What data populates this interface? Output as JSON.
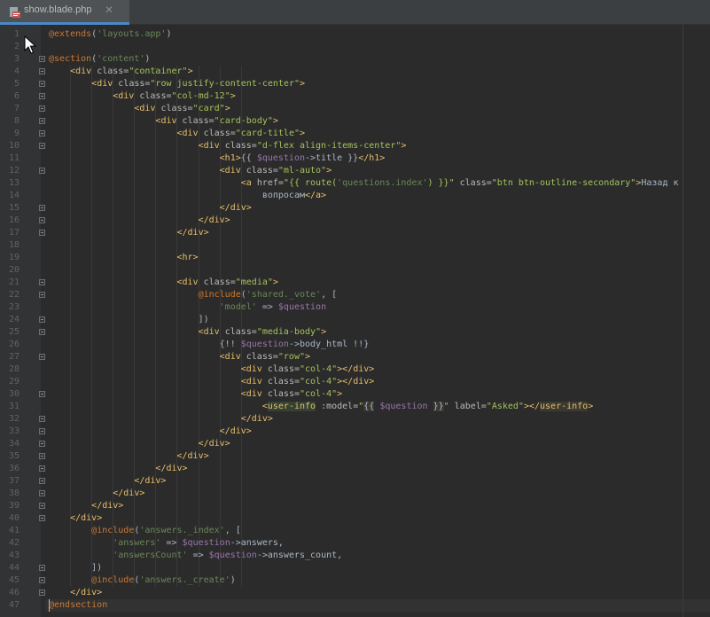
{
  "tab": {
    "title": "show.blade.php",
    "close_icon": "close-icon",
    "file_icon": "blade-file-icon",
    "accent": "#4a88c7"
  },
  "editor": {
    "line_numbers": [
      "1",
      "2",
      "3",
      "4",
      "5",
      "6",
      "7",
      "8",
      "9",
      "10",
      "11",
      "12",
      "13",
      "14",
      "15",
      "16",
      "17",
      "18",
      "19",
      "20",
      "21",
      "22",
      "23",
      "24",
      "25",
      "26",
      "27",
      "28",
      "29",
      "30",
      "31",
      "32",
      "33",
      "34",
      "35",
      "36",
      "37",
      "38",
      "39",
      "40",
      "41",
      "42",
      "43",
      "44",
      "45",
      "46",
      "47"
    ],
    "lines": [
      [
        [
          "t-dir",
          "@extends"
        ],
        [
          "t-txt",
          "("
        ],
        [
          "t-str",
          "'layouts.app'"
        ],
        [
          "t-txt",
          ")"
        ]
      ],
      [],
      [
        [
          "t-dir",
          "@section"
        ],
        [
          "t-txt",
          "("
        ],
        [
          "t-str",
          "'content'"
        ],
        [
          "t-txt",
          ")"
        ]
      ],
      [
        [
          "t-txt",
          "    "
        ],
        [
          "t-tag",
          "<div "
        ],
        [
          "t-attr",
          "class="
        ],
        [
          "t-val",
          "\"container\""
        ],
        [
          "t-tag",
          ">"
        ]
      ],
      [
        [
          "t-txt",
          "        "
        ],
        [
          "t-tag",
          "<div "
        ],
        [
          "t-attr",
          "class="
        ],
        [
          "t-val",
          "\"row justify-content-center\""
        ],
        [
          "t-tag",
          ">"
        ]
      ],
      [
        [
          "t-txt",
          "            "
        ],
        [
          "t-tag",
          "<div "
        ],
        [
          "t-attr",
          "class="
        ],
        [
          "t-val",
          "\"col-md-12\""
        ],
        [
          "t-tag",
          ">"
        ]
      ],
      [
        [
          "t-txt",
          "                "
        ],
        [
          "t-tag",
          "<div "
        ],
        [
          "t-attr",
          "class="
        ],
        [
          "t-val",
          "\"card\""
        ],
        [
          "t-tag",
          ">"
        ]
      ],
      [
        [
          "t-txt",
          "                    "
        ],
        [
          "t-tag",
          "<div "
        ],
        [
          "t-attr",
          "class="
        ],
        [
          "t-val",
          "\"card-body\""
        ],
        [
          "t-tag",
          ">"
        ]
      ],
      [
        [
          "t-txt",
          "                        "
        ],
        [
          "t-tag",
          "<div "
        ],
        [
          "t-attr",
          "class="
        ],
        [
          "t-val",
          "\"card-title\""
        ],
        [
          "t-tag",
          ">"
        ]
      ],
      [
        [
          "t-txt",
          "                            "
        ],
        [
          "t-tag",
          "<div "
        ],
        [
          "t-attr",
          "class="
        ],
        [
          "t-val",
          "\"d-flex align-items-center\""
        ],
        [
          "t-tag",
          ">"
        ]
      ],
      [
        [
          "t-txt",
          "                                "
        ],
        [
          "t-tag",
          "<h1>"
        ],
        [
          "t-txt",
          "{{ "
        ],
        [
          "t-var",
          "$question"
        ],
        [
          "t-txt",
          "->title }}"
        ],
        [
          "t-tag",
          "</h1>"
        ]
      ],
      [
        [
          "t-txt",
          "                                "
        ],
        [
          "t-tag",
          "<div "
        ],
        [
          "t-attr",
          "class="
        ],
        [
          "t-val",
          "\"ml-auto\""
        ],
        [
          "t-tag",
          ">"
        ]
      ],
      [
        [
          "t-txt",
          "                                    "
        ],
        [
          "t-tag",
          "<a "
        ],
        [
          "t-attr",
          "href="
        ],
        [
          "t-val",
          "\"{{ route("
        ],
        [
          "t-str",
          "'questions.index'"
        ],
        [
          "t-val",
          ") }}\""
        ],
        [
          "t-txt",
          " "
        ],
        [
          "t-attr",
          "class="
        ],
        [
          "t-val",
          "\"btn btn-outline-secondary\""
        ],
        [
          "t-tag",
          ">"
        ],
        [
          "t-txt",
          "Назад к"
        ]
      ],
      [
        [
          "t-txt",
          "                                        вопросам"
        ],
        [
          "t-tag",
          "</a>"
        ]
      ],
      [
        [
          "t-txt",
          "                                "
        ],
        [
          "t-tag",
          "</div>"
        ]
      ],
      [
        [
          "t-txt",
          "                            "
        ],
        [
          "t-tag",
          "</div>"
        ]
      ],
      [
        [
          "t-txt",
          "                        "
        ],
        [
          "t-tag",
          "</div>"
        ]
      ],
      [],
      [
        [
          "t-txt",
          "                        "
        ],
        [
          "t-tag",
          "<hr>"
        ]
      ],
      [],
      [
        [
          "t-txt",
          "                        "
        ],
        [
          "t-tag",
          "<div "
        ],
        [
          "t-attr",
          "class="
        ],
        [
          "t-val",
          "\"media\""
        ],
        [
          "t-tag",
          ">"
        ]
      ],
      [
        [
          "t-txt",
          "                            "
        ],
        [
          "t-dir",
          "@include"
        ],
        [
          "t-txt",
          "("
        ],
        [
          "t-str",
          "'shared._vote'"
        ],
        [
          "t-txt",
          ", ["
        ]
      ],
      [
        [
          "t-txt",
          "                                "
        ],
        [
          "t-str",
          "'model'"
        ],
        [
          "t-txt",
          " => "
        ],
        [
          "t-var",
          "$question"
        ]
      ],
      [
        [
          "t-txt",
          "                            ])"
        ]
      ],
      [
        [
          "t-txt",
          "                            "
        ],
        [
          "t-tag",
          "<div "
        ],
        [
          "t-attr",
          "class="
        ],
        [
          "t-val",
          "\"media-body\""
        ],
        [
          "t-tag",
          ">"
        ]
      ],
      [
        [
          "t-txt",
          "                                {!! "
        ],
        [
          "t-var",
          "$question"
        ],
        [
          "t-txt",
          "->body_html !!}"
        ]
      ],
      [
        [
          "t-txt",
          "                                "
        ],
        [
          "t-tag",
          "<div "
        ],
        [
          "t-attr",
          "class="
        ],
        [
          "t-val",
          "\"row\""
        ],
        [
          "t-tag",
          ">"
        ]
      ],
      [
        [
          "t-txt",
          "                                    "
        ],
        [
          "t-tag",
          "<div "
        ],
        [
          "t-attr",
          "class="
        ],
        [
          "t-val",
          "\"col-4\""
        ],
        [
          "t-tag",
          "></div>"
        ]
      ],
      [
        [
          "t-txt",
          "                                    "
        ],
        [
          "t-tag",
          "<div "
        ],
        [
          "t-attr",
          "class="
        ],
        [
          "t-val",
          "\"col-4\""
        ],
        [
          "t-tag",
          "></div>"
        ]
      ],
      [
        [
          "t-txt",
          "                                    "
        ],
        [
          "t-tag",
          "<div "
        ],
        [
          "t-attr",
          "class="
        ],
        [
          "t-val",
          "\"col-4\""
        ],
        [
          "t-tag",
          ">"
        ]
      ],
      [
        [
          "t-txt",
          "                                        "
        ],
        [
          "t-tag",
          "<"
        ],
        [
          "t-comp",
          "user-info"
        ],
        [
          "t-txt",
          " "
        ],
        [
          "t-attr",
          ":model="
        ],
        [
          "t-val",
          "\""
        ],
        [
          "t-hl",
          "{{"
        ],
        [
          "t-txt",
          " "
        ],
        [
          "t-var",
          "$question"
        ],
        [
          "t-txt",
          " "
        ],
        [
          "t-hl",
          "}}"
        ],
        [
          "t-val",
          "\""
        ],
        [
          "t-txt",
          " "
        ],
        [
          "t-attr",
          "label="
        ],
        [
          "t-val",
          "\"Asked\""
        ],
        [
          "t-tag",
          "></"
        ],
        [
          "t-comp2",
          "user-info"
        ],
        [
          "t-tag",
          ">"
        ]
      ],
      [
        [
          "t-txt",
          "                                    "
        ],
        [
          "t-tag",
          "</div>"
        ]
      ],
      [
        [
          "t-txt",
          "                                "
        ],
        [
          "t-tag",
          "</div>"
        ]
      ],
      [
        [
          "t-txt",
          "                            "
        ],
        [
          "t-tag",
          "</div>"
        ]
      ],
      [
        [
          "t-txt",
          "                        "
        ],
        [
          "t-tag",
          "</div>"
        ]
      ],
      [
        [
          "t-txt",
          "                    "
        ],
        [
          "t-tag",
          "</div>"
        ]
      ],
      [
        [
          "t-txt",
          "                "
        ],
        [
          "t-tag",
          "</div>"
        ]
      ],
      [
        [
          "t-txt",
          "            "
        ],
        [
          "t-tag",
          "</div>"
        ]
      ],
      [
        [
          "t-txt",
          "        "
        ],
        [
          "t-tag",
          "</div>"
        ]
      ],
      [
        [
          "t-txt",
          "    "
        ],
        [
          "t-tag",
          "</div>"
        ]
      ],
      [
        [
          "t-txt",
          "        "
        ],
        [
          "t-dir",
          "@include"
        ],
        [
          "t-txt",
          "("
        ],
        [
          "t-str",
          "'answers._index'"
        ],
        [
          "t-txt",
          ", ["
        ]
      ],
      [
        [
          "t-txt",
          "            "
        ],
        [
          "t-str",
          "'answers'"
        ],
        [
          "t-txt",
          " => "
        ],
        [
          "t-var",
          "$question"
        ],
        [
          "t-txt",
          "->answers,"
        ]
      ],
      [
        [
          "t-txt",
          "            "
        ],
        [
          "t-str",
          "'answersCount'"
        ],
        [
          "t-txt",
          " => "
        ],
        [
          "t-var",
          "$question"
        ],
        [
          "t-txt",
          "->answers_count,"
        ]
      ],
      [
        [
          "t-txt",
          "        ])"
        ]
      ],
      [
        [
          "t-txt",
          "        "
        ],
        [
          "t-dir",
          "@include"
        ],
        [
          "t-txt",
          "("
        ],
        [
          "t-str",
          "'answers._create'"
        ],
        [
          "t-txt",
          ")"
        ]
      ],
      [
        [
          "t-txt",
          "    "
        ],
        [
          "t-tag",
          "</div>"
        ]
      ],
      [
        [
          "t-dir",
          "@endsection"
        ]
      ],
      []
    ],
    "fold_lines": [
      3,
      4,
      5,
      6,
      7,
      8,
      9,
      10,
      12,
      15,
      16,
      17,
      21,
      22,
      24,
      25,
      27,
      30,
      32,
      33,
      34,
      35,
      36,
      37,
      38,
      39,
      40,
      44,
      45,
      46
    ],
    "current_line": 47
  }
}
